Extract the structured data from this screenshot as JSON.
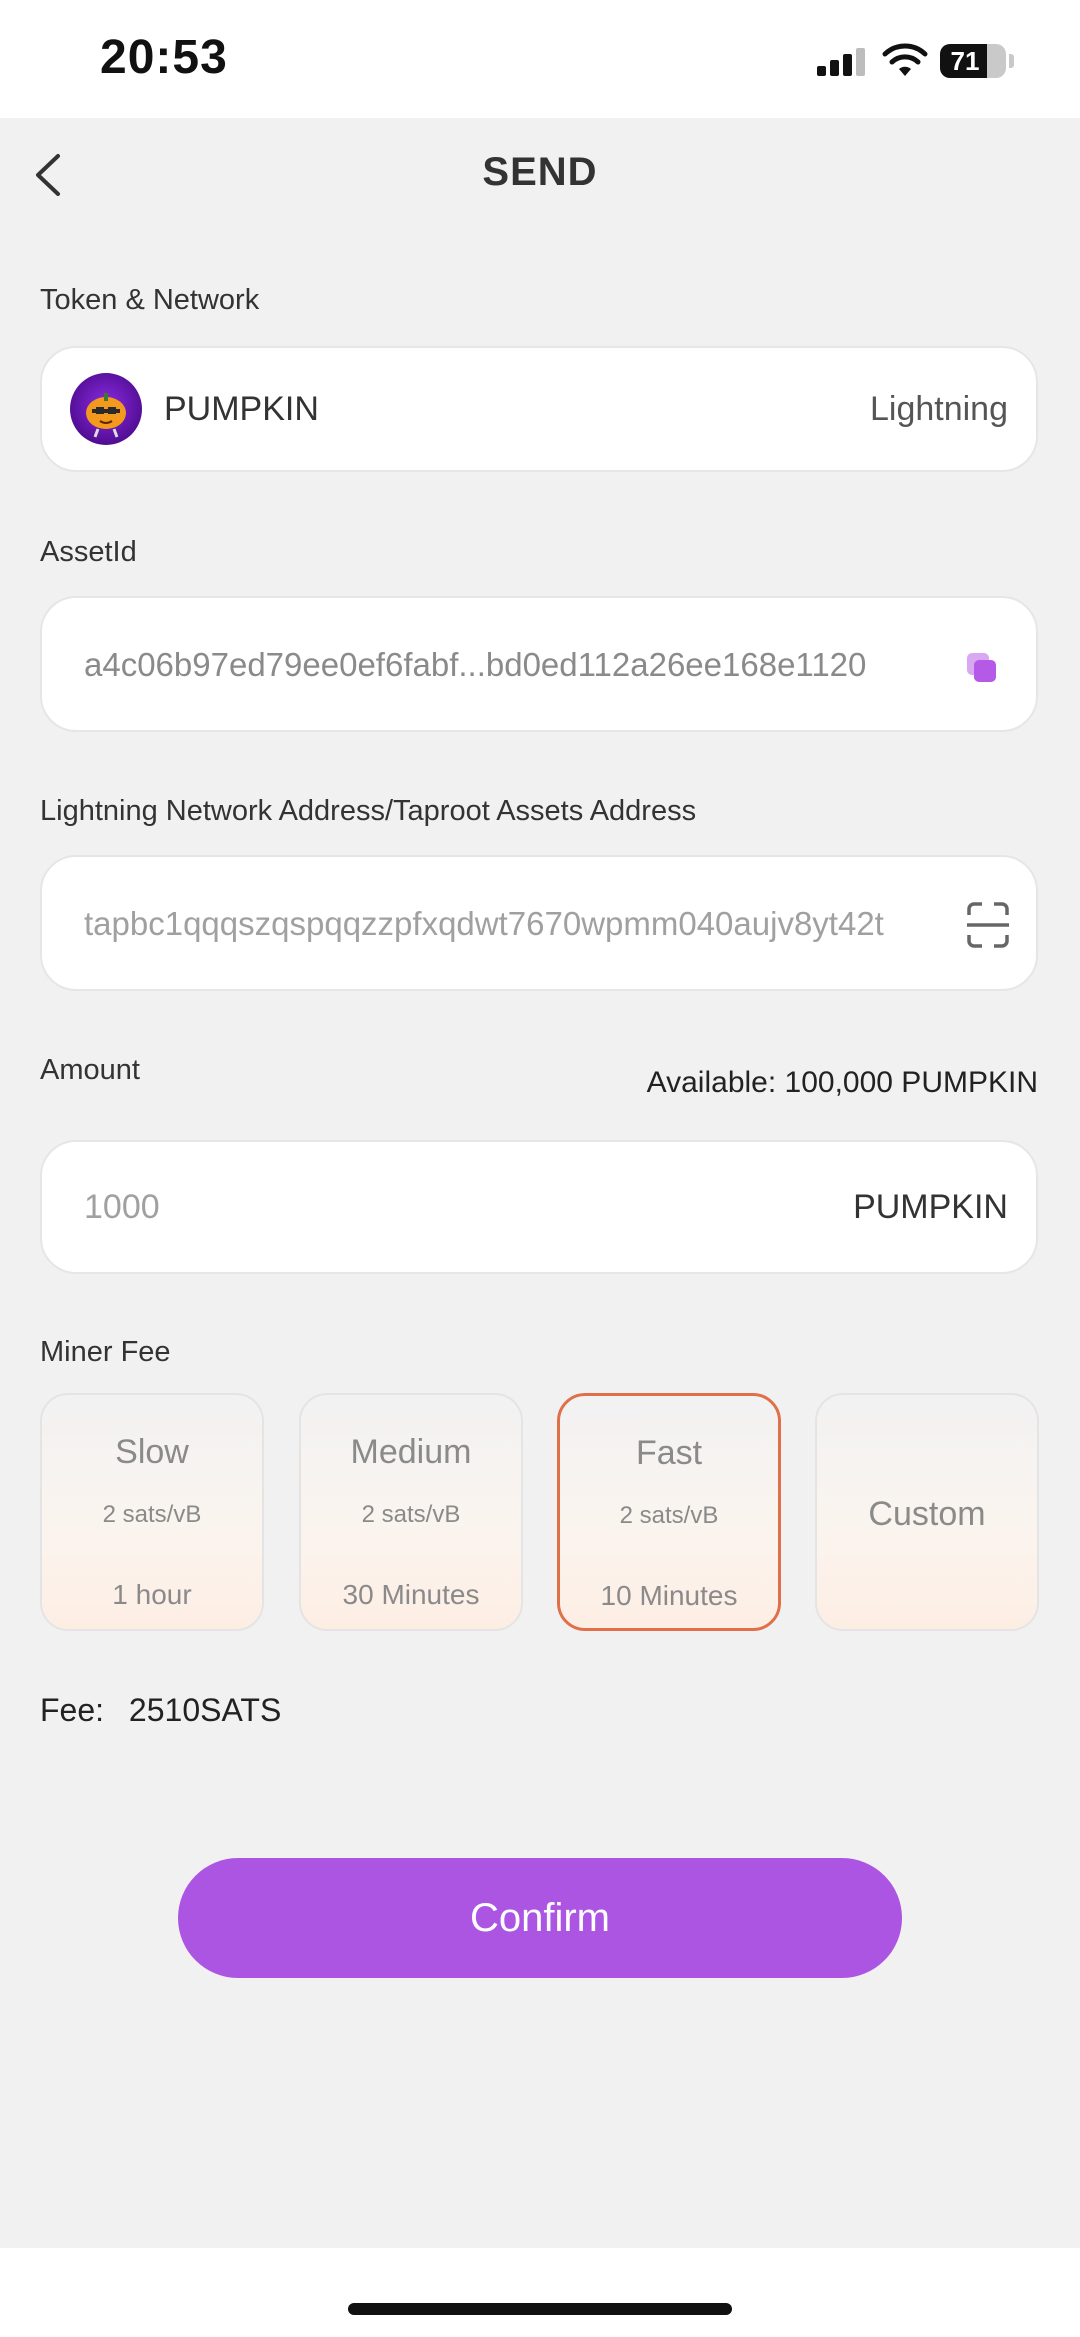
{
  "status_bar": {
    "time": "20:53",
    "battery": "71",
    "battery_level": 0.71
  },
  "header": {
    "title": "SEND"
  },
  "token_network": {
    "label": "Token & Network",
    "token": "PUMPKIN",
    "network": "Lightning"
  },
  "asset_id": {
    "label": "AssetId",
    "value": "a4c06b97ed79ee0ef6fabf...bd0ed112a26ee168e1120"
  },
  "address": {
    "label": "Lightning Network Address/Taproot Assets Address",
    "value": "tapbc1qqqszqspqqzzpfxqdwt7670wpmm040aujv8yt42t"
  },
  "amount": {
    "label": "Amount",
    "available": "Available: 100,000 PUMPKIN",
    "value": "1000",
    "unit": "PUMPKIN"
  },
  "miner_fee": {
    "label": "Miner Fee",
    "options": [
      {
        "name": "Slow",
        "rate": "2 sats/vB",
        "time": "1 hour"
      },
      {
        "name": "Medium",
        "rate": "2 sats/vB",
        "time": "30 Minutes"
      },
      {
        "name": "Fast",
        "rate": "2 sats/vB",
        "time": "10 Minutes",
        "selected": true
      },
      {
        "name": "Custom"
      }
    ]
  },
  "fee": {
    "label": "Fee:",
    "value": "2510SATS"
  },
  "confirm_label": "Confirm",
  "colors": {
    "accent": "#ad55e3",
    "selected_border": "#e0704a",
    "copy_icon": "#b45ae6"
  }
}
